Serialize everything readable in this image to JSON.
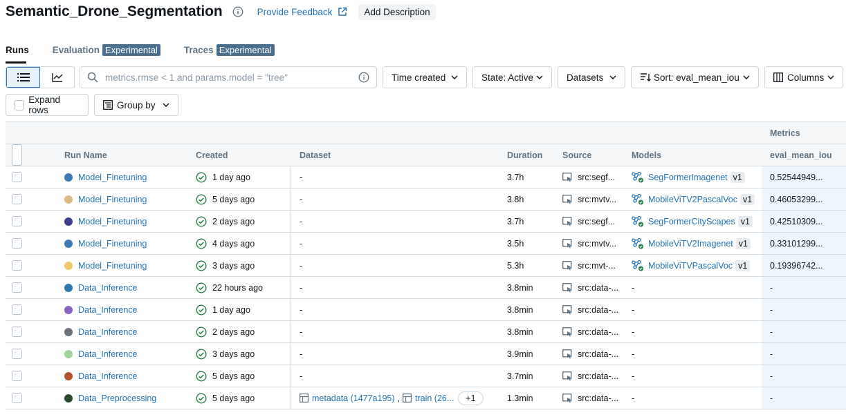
{
  "header": {
    "title": "Semantic_Drone_Segmentation",
    "feedback_label": "Provide Feedback",
    "add_description_label": "Add Description"
  },
  "tabs": [
    {
      "label": "Runs",
      "badge": ""
    },
    {
      "label": "Evaluation",
      "badge": "Experimental"
    },
    {
      "label": "Traces",
      "badge": "Experimental"
    }
  ],
  "toolbar": {
    "search_placeholder": "metrics.rmse < 1 and params.model = \"tree\"",
    "time_created_label": "Time created",
    "state_label": "State: Active",
    "datasets_label": "Datasets",
    "sort_label": "Sort: eval_mean_iou",
    "columns_label": "Columns",
    "expand_rows_label": "Expand rows",
    "group_by_label": "Group by"
  },
  "table": {
    "group_header": "Metrics",
    "columns": [
      "Run Name",
      "Created",
      "Dataset",
      "Duration",
      "Source",
      "Models",
      "eval_mean_iou"
    ],
    "rows": [
      {
        "color": "#3d7ab8",
        "name": "Model_Finetuning",
        "created": "1 day ago",
        "dataset": "-",
        "duration": "3.7h",
        "source": "src:segf...",
        "model": "SegFormerImagenet",
        "version": "v1",
        "metric": "0.52544949..."
      },
      {
        "color": "#deb887",
        "name": "Model_Finetuning",
        "created": "5 days ago",
        "dataset": "-",
        "duration": "3.8h",
        "source": "src:mvtv...",
        "model": "MobileViTV2PascalVoc",
        "version": "v1",
        "metric": "0.46053299..."
      },
      {
        "color": "#3f3d8f",
        "name": "Model_Finetuning",
        "created": "2 days ago",
        "dataset": "-",
        "duration": "3.7h",
        "source": "src:segf...",
        "model": "SegFormerCityScapes",
        "version": "v1",
        "metric": "0.42510309..."
      },
      {
        "color": "#3d7ab8",
        "name": "Model_Finetuning",
        "created": "4 days ago",
        "dataset": "-",
        "duration": "3.5h",
        "source": "src:mvtv...",
        "model": "MobileViTV2Imagenet",
        "version": "v1",
        "metric": "0.33101299..."
      },
      {
        "color": "#f2c76b",
        "name": "Model_Finetuning",
        "created": "3 days ago",
        "dataset": "-",
        "duration": "5.3h",
        "source": "src:mvt-...",
        "model": "MobileViTVPascalVoc",
        "version": "v1",
        "metric": "0.19396742..."
      },
      {
        "color": "#2f79b0",
        "name": "Data_Inference",
        "created": "22 hours ago",
        "dataset": "-",
        "duration": "3.8min",
        "source": "src:data-...",
        "model": "-",
        "version": "",
        "metric": "-"
      },
      {
        "color": "#8a61c4",
        "name": "Data_Inference",
        "created": "1 day ago",
        "dataset": "-",
        "duration": "3.8min",
        "source": "src:data-...",
        "model": "-",
        "version": "",
        "metric": "-"
      },
      {
        "color": "#6b7279",
        "name": "Data_Inference",
        "created": "2 days ago",
        "dataset": "-",
        "duration": "3.8min",
        "source": "src:data-...",
        "model": "-",
        "version": "",
        "metric": "-"
      },
      {
        "color": "#9ed39a",
        "name": "Data_Inference",
        "created": "3 days ago",
        "dataset": "-",
        "duration": "3.9min",
        "source": "src:data-...",
        "model": "-",
        "version": "",
        "metric": "-"
      },
      {
        "color": "#b5522a",
        "name": "Data_Inference",
        "created": "5 days ago",
        "dataset": "-",
        "duration": "3.7min",
        "source": "src:data-...",
        "model": "-",
        "version": "",
        "metric": "-"
      },
      {
        "color": "#284a2a",
        "name": "Data_Preprocessing",
        "created": "5 days ago",
        "dataset_items": [
          "metadata (1477a195)",
          "train (26..."
        ],
        "dataset_more": "+1",
        "duration": "1.3min",
        "source": "src:data-...",
        "model": "-",
        "version": "",
        "metric": "-"
      }
    ]
  }
}
